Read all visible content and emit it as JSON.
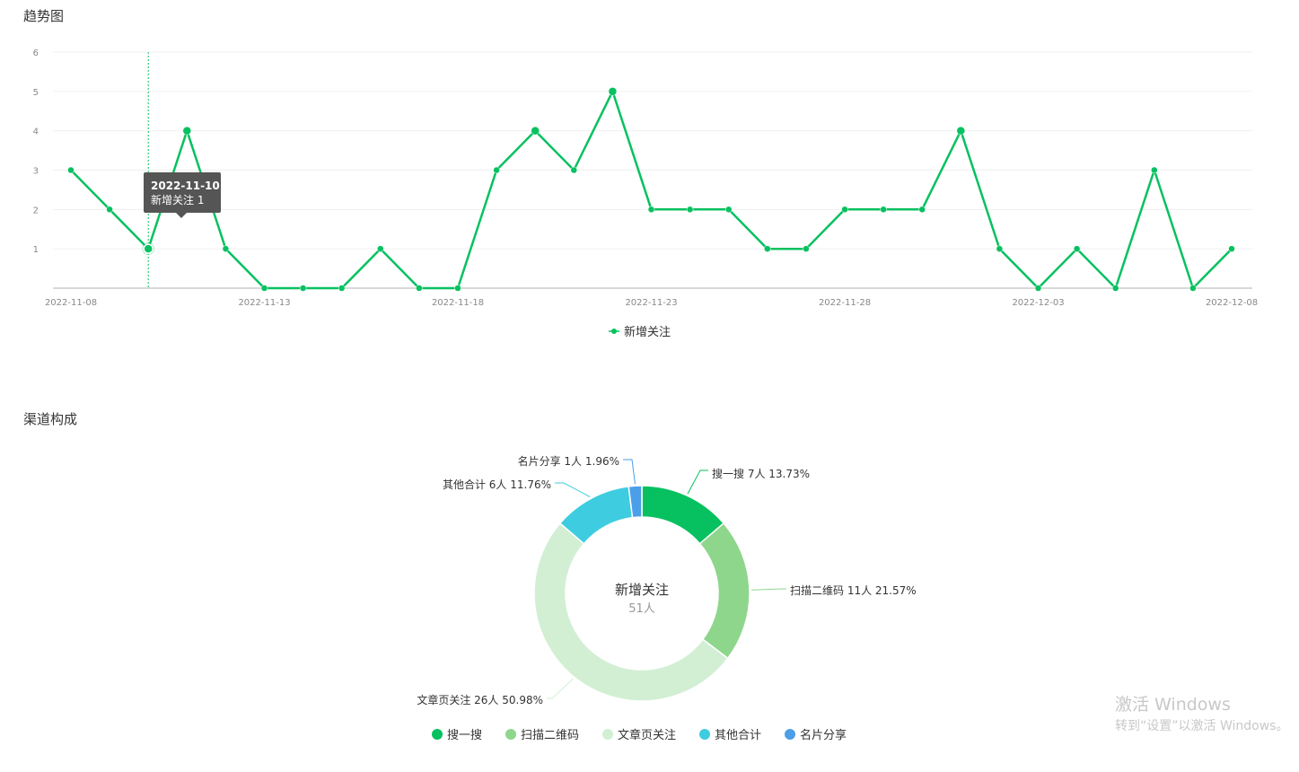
{
  "trend": {
    "title": "趋势图",
    "tooltip": {
      "date": "2022-11-10",
      "text": "新增关注 1"
    }
  },
  "channel": {
    "title": "渠道构成",
    "center_title": "新增关注",
    "center_value": "51人"
  },
  "watermark": {
    "line1": "激活 Windows",
    "line2": "转到“设置”以激活 Windows。"
  },
  "colors": {
    "line": "#07c160",
    "grid": "#f0f0f0",
    "axis": "#cccccc"
  },
  "chart_data": [
    {
      "type": "line",
      "x": [
        "2022-11-08",
        "2022-11-09",
        "2022-11-10",
        "2022-11-11",
        "2022-11-12",
        "2022-11-13",
        "2022-11-14",
        "2022-11-15",
        "2022-11-16",
        "2022-11-17",
        "2022-11-18",
        "2022-11-19",
        "2022-11-20",
        "2022-11-21",
        "2022-11-22",
        "2022-11-23",
        "2022-11-24",
        "2022-11-25",
        "2022-11-26",
        "2022-11-27",
        "2022-11-28",
        "2022-11-29",
        "2022-11-30",
        "2022-12-01",
        "2022-12-02",
        "2022-12-03",
        "2022-12-04",
        "2022-12-05",
        "2022-12-06",
        "2022-12-07",
        "2022-12-08"
      ],
      "x_tick_labels": [
        "2022-11-08",
        "2022-11-13",
        "2022-11-18",
        "2022-11-23",
        "2022-11-28",
        "2022-12-03",
        "2022-12-08"
      ],
      "y_ticks": [
        "1",
        "2",
        "3",
        "4",
        "5",
        "6"
      ],
      "ylim": [
        0,
        6
      ],
      "grid": true,
      "legend": "bottom-center",
      "series": [
        {
          "name": "新增关注",
          "color": "#07c160",
          "values": [
            3,
            2,
            1,
            4,
            1,
            0,
            0,
            0,
            1,
            0,
            0,
            3,
            4,
            3,
            5,
            2,
            2,
            2,
            1,
            1,
            2,
            2,
            2,
            4,
            1,
            0,
            1,
            0,
            3,
            0,
            1
          ]
        }
      ]
    },
    {
      "type": "pie",
      "legend": "bottom-center",
      "slices": [
        {
          "name": "搜一搜",
          "value": 7,
          "label": "搜一搜 7人 13.73%",
          "color": "#07c160"
        },
        {
          "name": "扫描二维码",
          "value": 11,
          "label": "扫描二维码 11人 21.57%",
          "color": "#8ed68c"
        },
        {
          "name": "文章页关注",
          "value": 26,
          "label": "文章页关注 26人 50.98%",
          "color": "#d2efd3"
        },
        {
          "name": "其他合计",
          "value": 6,
          "label": "其他合计 6人 11.76%",
          "color": "#3ecde0"
        },
        {
          "name": "名片分享",
          "value": 1,
          "label": "名片分享 1人 1.96%",
          "color": "#4b9ee8"
        }
      ]
    }
  ]
}
